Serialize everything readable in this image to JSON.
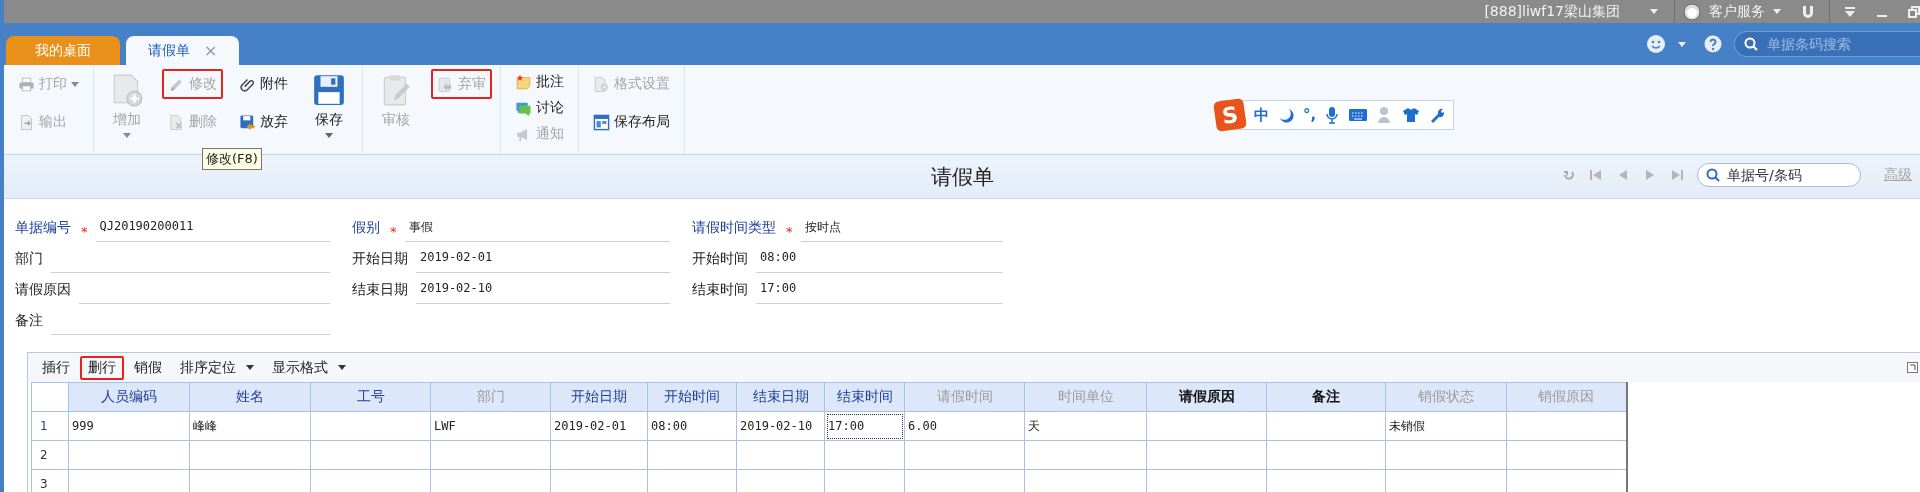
{
  "title_bar": {
    "company": "[888]liwf17梁山集团",
    "service": "客户服务"
  },
  "tabs": [
    {
      "label": "我的桌面",
      "selected": false,
      "kind": "home"
    },
    {
      "label": "请假单",
      "selected": true,
      "kind": "document",
      "close": "×"
    }
  ],
  "global_search": {
    "placeholder": "单据条码搜索"
  },
  "toolbar": {
    "print": {
      "label": "打印",
      "kind": "small",
      "disabled": true,
      "dropdown": true,
      "highlighted": false
    },
    "export": {
      "label": "输出",
      "kind": "small",
      "disabled": true,
      "dropdown": false,
      "highlighted": false
    },
    "add": {
      "label": "增加",
      "kind": "large",
      "disabled": true,
      "dropdown": true,
      "highlighted": false
    },
    "edit": {
      "label": "修改",
      "kind": "small",
      "disabled": true,
      "dropdown": false,
      "highlighted": true
    },
    "delete": {
      "label": "删除",
      "kind": "small",
      "disabled": true,
      "dropdown": false,
      "highlighted": false
    },
    "attach": {
      "label": "附件",
      "kind": "small",
      "disabled": false,
      "dropdown": false,
      "highlighted": false
    },
    "discard": {
      "label": "放弃",
      "kind": "small",
      "disabled": false,
      "dropdown": false,
      "highlighted": false
    },
    "save": {
      "label": "保存",
      "kind": "large",
      "disabled": false,
      "dropdown": true,
      "highlighted": false
    },
    "approve": {
      "label": "审核",
      "kind": "large",
      "disabled": true,
      "dropdown": false,
      "highlighted": false
    },
    "unapprove": {
      "label": "弃审",
      "kind": "small",
      "disabled": true,
      "dropdown": false,
      "highlighted": true
    },
    "comment": {
      "label": "批注",
      "kind": "small",
      "disabled": false,
      "dropdown": false,
      "highlighted": false
    },
    "discuss": {
      "label": "讨论",
      "kind": "small",
      "disabled": false,
      "dropdown": false,
      "highlighted": false
    },
    "notify": {
      "label": "通知",
      "kind": "small",
      "disabled": true,
      "dropdown": false,
      "highlighted": false
    },
    "format": {
      "label": "格式设置",
      "kind": "small",
      "disabled": true,
      "dropdown": false,
      "highlighted": false
    },
    "save_layout": {
      "label": "保存布局",
      "kind": "small",
      "disabled": false,
      "dropdown": false,
      "highlighted": false
    }
  },
  "tooltip": "修改(F8)",
  "ime_bar": {
    "logo": "S",
    "mode": "中",
    "punctuation": "°,"
  },
  "form_title": "请假单",
  "record_search": {
    "placeholder": "单据号/条码"
  },
  "advanced_link": {
    "label": "高级",
    "disabled": true
  },
  "form": {
    "columns": [
      [
        {
          "label": "单据编号",
          "required": true,
          "required_mark": "*",
          "value": "QJ20190200011"
        },
        {
          "label": "部门",
          "required": false
        },
        {
          "label": "请假原因",
          "required": false
        },
        {
          "label": "备注",
          "required": false
        }
      ],
      [
        {
          "label": "假别",
          "required": true,
          "required_mark": "*",
          "value": "事假"
        },
        {
          "label": "开始日期",
          "required": false,
          "value": "2019-02-01"
        },
        {
          "label": "结束日期",
          "required": false,
          "value": "2019-02-10"
        }
      ],
      [
        {
          "label": "请假时间类型",
          "required": true,
          "required_mark": "*",
          "value": "按时点"
        },
        {
          "label": "开始时间",
          "required": false,
          "value": "08:00"
        },
        {
          "label": "结束时间",
          "required": false,
          "value": "17:00"
        }
      ]
    ]
  },
  "grid_toolbar": [
    {
      "label": "插行",
      "dropdown": false,
      "highlighted": false
    },
    {
      "label": "删行",
      "dropdown": false,
      "highlighted": true
    },
    {
      "label": "销假",
      "dropdown": false,
      "highlighted": false
    },
    {
      "label": "排序定位",
      "dropdown": true,
      "highlighted": false
    },
    {
      "label": "显示格式",
      "dropdown": true,
      "highlighted": false
    }
  ],
  "table": {
    "columns": [
      {
        "label": "人员编码",
        "kind": "lookup",
        "disabled": false,
        "current": false
      },
      {
        "label": "姓名",
        "kind": "lookup",
        "disabled": false,
        "current": false
      },
      {
        "label": "工号",
        "kind": "lookup",
        "disabled": false,
        "current": false
      },
      {
        "label": "部门",
        "kind": "lookup",
        "disabled": true,
        "current": false
      },
      {
        "label": "开始日期",
        "kind": "lookup",
        "disabled": false,
        "current": false
      },
      {
        "label": "开始时间",
        "kind": "lookup",
        "disabled": false,
        "current": false
      },
      {
        "label": "结束日期",
        "kind": "lookup",
        "disabled": false,
        "current": false
      },
      {
        "label": "结束时间",
        "kind": "lookup",
        "disabled": false,
        "current": true
      },
      {
        "label": "请假时间",
        "kind": "lookup",
        "disabled": true,
        "current": false
      },
      {
        "label": "时间单位",
        "kind": "lookup",
        "disabled": true,
        "current": false
      },
      {
        "label": "请假原因",
        "kind": "plain",
        "disabled": false,
        "current": false
      },
      {
        "label": "备注",
        "kind": "plain",
        "disabled": false,
        "current": false
      },
      {
        "label": "销假状态",
        "kind": "lookup",
        "disabled": true,
        "current": false
      },
      {
        "label": "销假原因",
        "kind": "lookup",
        "disabled": true,
        "current": false
      }
    ],
    "rows": [
      {
        "number": "1",
        "current": true,
        "cells": [
          "999",
          "峰峰",
          null,
          "LWF",
          "2019-02-01",
          "08:00",
          "2019-02-10",
          "17:00",
          "6.00",
          "天",
          null,
          null,
          "未销假",
          null
        ]
      },
      {
        "number": "2",
        "current": false
      },
      {
        "number": "3",
        "current": false
      }
    ]
  }
}
